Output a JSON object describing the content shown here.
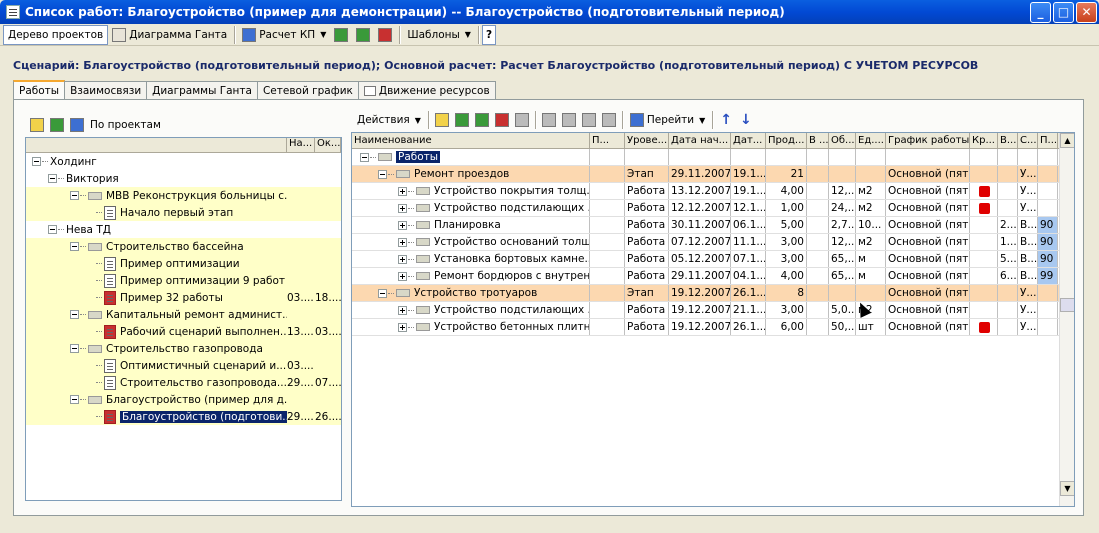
{
  "window": {
    "title": "Список работ: Благоустройство (пример для демонстрации) -- Благоустройство (подготовительный период)"
  },
  "toolbar": {
    "project_tree": "Дерево проектов",
    "gantt": "Диаграмма Ганта",
    "calc_kp": "Расчет КП",
    "templates": "Шаблоны",
    "help": "?"
  },
  "scenario": "Сценарий: Благоустройство (подготовительный период); Основной расчет: Расчет Благоустройство (подготовительный период) С УЧЕТОМ РЕСУРСОВ",
  "tabs": [
    "Работы",
    "Взаимосвязи",
    "Диаграммы Ганта",
    "Сетевой график",
    "Движение ресурсов"
  ],
  "left": {
    "by_projects": "По проектам",
    "headers": [
      "На...",
      "Ок..."
    ],
    "items": [
      {
        "label": "Холдинг",
        "c1": "",
        "c2": ""
      },
      {
        "label": "Виктория",
        "c1": "",
        "c2": ""
      },
      {
        "label": "МВВ Реконструкция больницы с...",
        "c1": "",
        "c2": ""
      },
      {
        "label": "Начало первый этап",
        "c1": "",
        "c2": ""
      },
      {
        "label": "Нева ТД",
        "c1": "",
        "c2": ""
      },
      {
        "label": "Строительство бассейна",
        "c1": "",
        "c2": ""
      },
      {
        "label": "Пример оптимизации",
        "c1": "",
        "c2": ""
      },
      {
        "label": "Пример оптимизации 9 работ",
        "c1": "",
        "c2": ""
      },
      {
        "label": "Пример 32 работы",
        "c1": "03....",
        "c2": "18...."
      },
      {
        "label": "Капитальный ремонт админист...",
        "c1": "",
        "c2": ""
      },
      {
        "label": "Рабочий сценарий выполнен...",
        "c1": "13....",
        "c2": "03...."
      },
      {
        "label": "Строительство газопровода",
        "c1": "",
        "c2": ""
      },
      {
        "label": "Оптимистичный сценарий и...",
        "c1": "03....",
        "c2": ""
      },
      {
        "label": "Строительство газопровода...",
        "c1": "29....",
        "c2": "07...."
      },
      {
        "label": "Благоустройство (пример для д...",
        "c1": "",
        "c2": ""
      },
      {
        "label": "Благоустройство (подготови...",
        "c1": "29....",
        "c2": "26...."
      }
    ]
  },
  "right": {
    "actions": "Действия",
    "goto": "Перейти",
    "headers": [
      "Наименование",
      "П...",
      "Урове...",
      "Дата нач...",
      "Дат...",
      "Прод...",
      "В ...",
      "Об...",
      "Ед....",
      "График работы",
      "Кр...",
      "В...",
      "С...",
      "П..."
    ],
    "rows": [
      {
        "name": "Работы",
        "type": "",
        "start": "",
        "end": "",
        "dur": "",
        "vol": "",
        "unit": "",
        "sched": "",
        "crit": false,
        "b": "",
        "c": "",
        "p": ""
      },
      {
        "name": "Ремонт проездов",
        "type": "Этап",
        "start": "29.11.2007",
        "end": "19.1...",
        "dur": "21",
        "vol": "",
        "unit": "",
        "sched": "Основной (пят...",
        "crit": false,
        "b": "",
        "c": "У...",
        "p": ""
      },
      {
        "name": "Устройство покрытия толщ...",
        "type": "Работа",
        "start": "13.12.2007",
        "end": "19.1...",
        "dur": "4,00",
        "vol": "12,...",
        "unit": "м2",
        "sched": "Основной (пят...",
        "crit": true,
        "b": "",
        "c": "У...",
        "p": ""
      },
      {
        "name": "Устройство подстилающих ...",
        "type": "Работа",
        "start": "12.12.2007",
        "end": "12.1...",
        "dur": "1,00",
        "vol": "24,...",
        "unit": "м2",
        "sched": "Основной (пят...",
        "crit": true,
        "b": "",
        "c": "У...",
        "p": ""
      },
      {
        "name": "Планировка",
        "type": "Работа",
        "start": "30.11.2007",
        "end": "06.1...",
        "dur": "5,00",
        "vol": "2,7...",
        "unit": "10...",
        "sched": "Основной (пят...",
        "crit": false,
        "b": "2...",
        "c": "В...",
        "p": "90"
      },
      {
        "name": "Устройство оснований толщ...",
        "type": "Работа",
        "start": "07.12.2007",
        "end": "11.1...",
        "dur": "3,00",
        "vol": "12,...",
        "unit": "м2",
        "sched": "Основной (пят...",
        "crit": false,
        "b": "1...",
        "c": "В...",
        "p": "90"
      },
      {
        "name": "Установка бортовых камне...",
        "type": "Работа",
        "start": "05.12.2007",
        "end": "07.1...",
        "dur": "3,00",
        "vol": "65,...",
        "unit": "м",
        "sched": "Основной (пят...",
        "crit": false,
        "b": "5...",
        "c": "В...",
        "p": "90"
      },
      {
        "name": "Ремонт бордюров с внутрен...",
        "type": "Работа",
        "start": "29.11.2007",
        "end": "04.1...",
        "dur": "4,00",
        "vol": "65,...",
        "unit": "м",
        "sched": "Основной (пят...",
        "crit": false,
        "b": "6...",
        "c": "В...",
        "p": "99"
      },
      {
        "name": "Устройство тротуаров",
        "type": "Этап",
        "start": "19.12.2007",
        "end": "26.1...",
        "dur": "8",
        "vol": "",
        "unit": "",
        "sched": "Основной (пят...",
        "crit": false,
        "b": "",
        "c": "У...",
        "p": ""
      },
      {
        "name": "Устройство подстилающих ...",
        "type": "Работа",
        "start": "19.12.2007",
        "end": "21.1...",
        "dur": "3,00",
        "vol": "5,0...",
        "unit": "м2",
        "sched": "Основной (пят...",
        "crit": false,
        "b": "",
        "c": "У...",
        "p": ""
      },
      {
        "name": "Устройство бетонных плитн...",
        "type": "Работа",
        "start": "19.12.2007",
        "end": "26.1...",
        "dur": "6,00",
        "vol": "50,...",
        "unit": "шт",
        "sched": "Основной (пят...",
        "crit": true,
        "b": "",
        "c": "У...",
        "p": ""
      }
    ]
  }
}
